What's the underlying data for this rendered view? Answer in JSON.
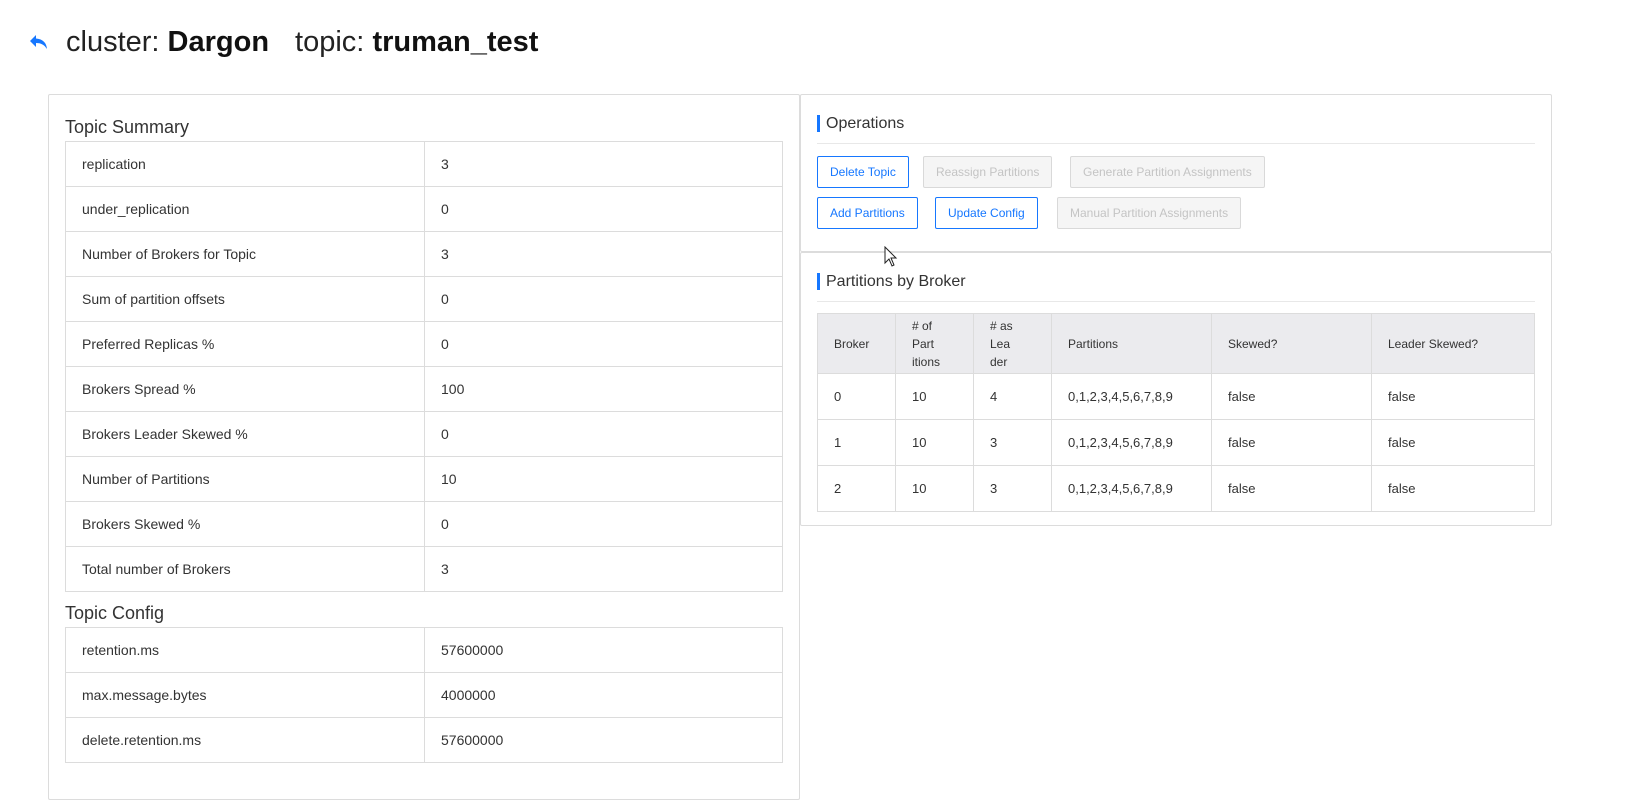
{
  "header": {
    "cluster_label": "cluster:",
    "cluster_name": "Dargon",
    "topic_label": "topic:",
    "topic_name": "truman_test",
    "back_icon": "back-arrow-icon"
  },
  "topic_summary": {
    "title": "Topic Summary",
    "rows": [
      {
        "key": "replication",
        "value": "3"
      },
      {
        "key": "under_replication",
        "value": "0"
      },
      {
        "key": "Number of Brokers for Topic",
        "value": "3"
      },
      {
        "key": "Sum of partition offsets",
        "value": "0"
      },
      {
        "key": "Preferred Replicas %",
        "value": "0"
      },
      {
        "key": "Brokers Spread %",
        "value": "100"
      },
      {
        "key": "Brokers Leader Skewed %",
        "value": "0"
      },
      {
        "key": "Number of Partitions",
        "value": "10"
      },
      {
        "key": "Brokers Skewed %",
        "value": "0"
      },
      {
        "key": "Total number of Brokers",
        "value": "3"
      }
    ]
  },
  "topic_config": {
    "title": "Topic Config",
    "rows": [
      {
        "key": "retention.ms",
        "value": "57600000"
      },
      {
        "key": "max.message.bytes",
        "value": "4000000"
      },
      {
        "key": "delete.retention.ms",
        "value": "57600000"
      }
    ]
  },
  "operations": {
    "title": "Operations",
    "buttons": {
      "delete_topic": "Delete Topic",
      "reassign_partitions": "Reassign Partitions",
      "generate_partition_assignments": "Generate Partition Assignments",
      "add_partitions": "Add Partitions",
      "update_config": "Update Config",
      "manual_partition_assignments": "Manual Partition Assignments"
    }
  },
  "partitions_by_broker": {
    "title": "Partitions by Broker",
    "columns": {
      "broker": "Broker",
      "num_partitions_1": "# of Part",
      "num_partitions_2": "itions",
      "as_leader_1": "# as Lea",
      "as_leader_2": "der",
      "partitions": "Partitions",
      "skewed": "Skewed?",
      "leader_skewed": "Leader Skewed?"
    },
    "rows": [
      {
        "broker": "0",
        "num_partitions": "10",
        "as_leader": "4",
        "partitions": "0,1,2,3,4,5,6,7,8,9",
        "skewed": "false",
        "leader_skewed": "false"
      },
      {
        "broker": "1",
        "num_partitions": "10",
        "as_leader": "3",
        "partitions": "0,1,2,3,4,5,6,7,8,9",
        "skewed": "false",
        "leader_skewed": "false"
      },
      {
        "broker": "2",
        "num_partitions": "10",
        "as_leader": "3",
        "partitions": "0,1,2,3,4,5,6,7,8,9",
        "skewed": "false",
        "leader_skewed": "false"
      }
    ]
  },
  "colors": {
    "accent": "#1677ff",
    "border": "#dcdcdc",
    "table_header_bg": "#ebebee"
  }
}
